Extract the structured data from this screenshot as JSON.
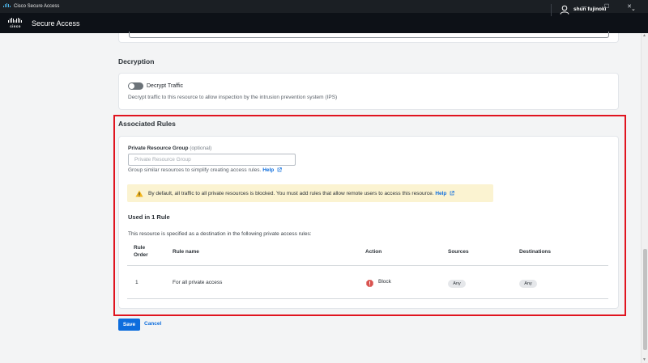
{
  "window": {
    "title": "Cisco Secure Access",
    "controls": [
      "—",
      "☐",
      "✕"
    ]
  },
  "header": {
    "logo_text": "cisco",
    "app_name": "Secure Access",
    "user_name": "shun fujinoki",
    "caret": "⌄"
  },
  "decryption": {
    "title": "Decryption",
    "toggle_label": "Decrypt Traffic",
    "toggle_on": false,
    "description": "Decrypt traffic to this resource to allow inspection by the intrusion prevention system (IPS)"
  },
  "associated_rules": {
    "title": "Associated Rules",
    "group_label": "Private Resource Group",
    "group_optional": "(optional)",
    "group_placeholder": "Private Resource Group",
    "group_hint": "Group similar resources to simplify creating access rules.",
    "help_label": "Help",
    "warning_text": "By default, all traffic to all private resources is blocked. You must add rules that allow remote users to access this resource.",
    "used_title": "Used in 1 Rule",
    "used_desc": "This resource is specified as a destination in the following private access rules:",
    "columns": {
      "rule_order_line1": "Rule",
      "rule_order_line2": "Order",
      "rule_name": "Rule name",
      "action": "Action",
      "sources": "Sources",
      "destinations": "Destinations"
    },
    "rows": [
      {
        "order": "1",
        "name": "For all private access",
        "action": "Block",
        "sources": "Any",
        "destinations": "Any"
      }
    ]
  },
  "footer": {
    "save_label": "Save",
    "cancel_label": "Cancel"
  },
  "colors": {
    "accent": "#0d6ddd",
    "highlight": "#e0141f",
    "block": "#d9534f",
    "warning_bg": "#fbf3d1"
  }
}
